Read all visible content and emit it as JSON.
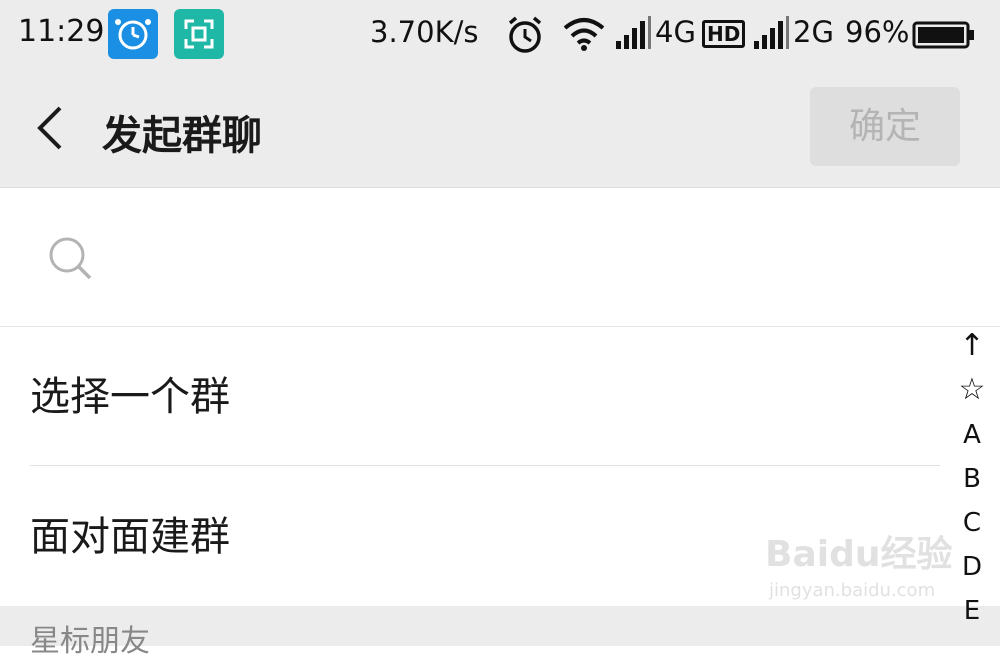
{
  "status_bar": {
    "time": "11:29",
    "network_speed": "3.70K/s",
    "network_4g": "4G",
    "hd_badge": "HD",
    "network_2g": "2G",
    "battery_percent": "96%"
  },
  "header": {
    "title": "发起群聊",
    "confirm_label": "确定"
  },
  "search": {
    "placeholder": ""
  },
  "list": {
    "items": [
      {
        "label": "选择一个群"
      },
      {
        "label": "面对面建群"
      }
    ],
    "section_header": "星标朋友"
  },
  "index_bar": {
    "items": [
      "↑",
      "☆",
      "A",
      "B",
      "C",
      "D",
      "E"
    ]
  },
  "watermark": {
    "main": "Baidu经验",
    "sub": "jingyan.baidu.com"
  },
  "colors": {
    "header_bg": "#ececec",
    "confirm_disabled_text": "#b4b4b4",
    "badge_blue": "#1a8fe3",
    "badge_teal": "#1fb8a6"
  }
}
